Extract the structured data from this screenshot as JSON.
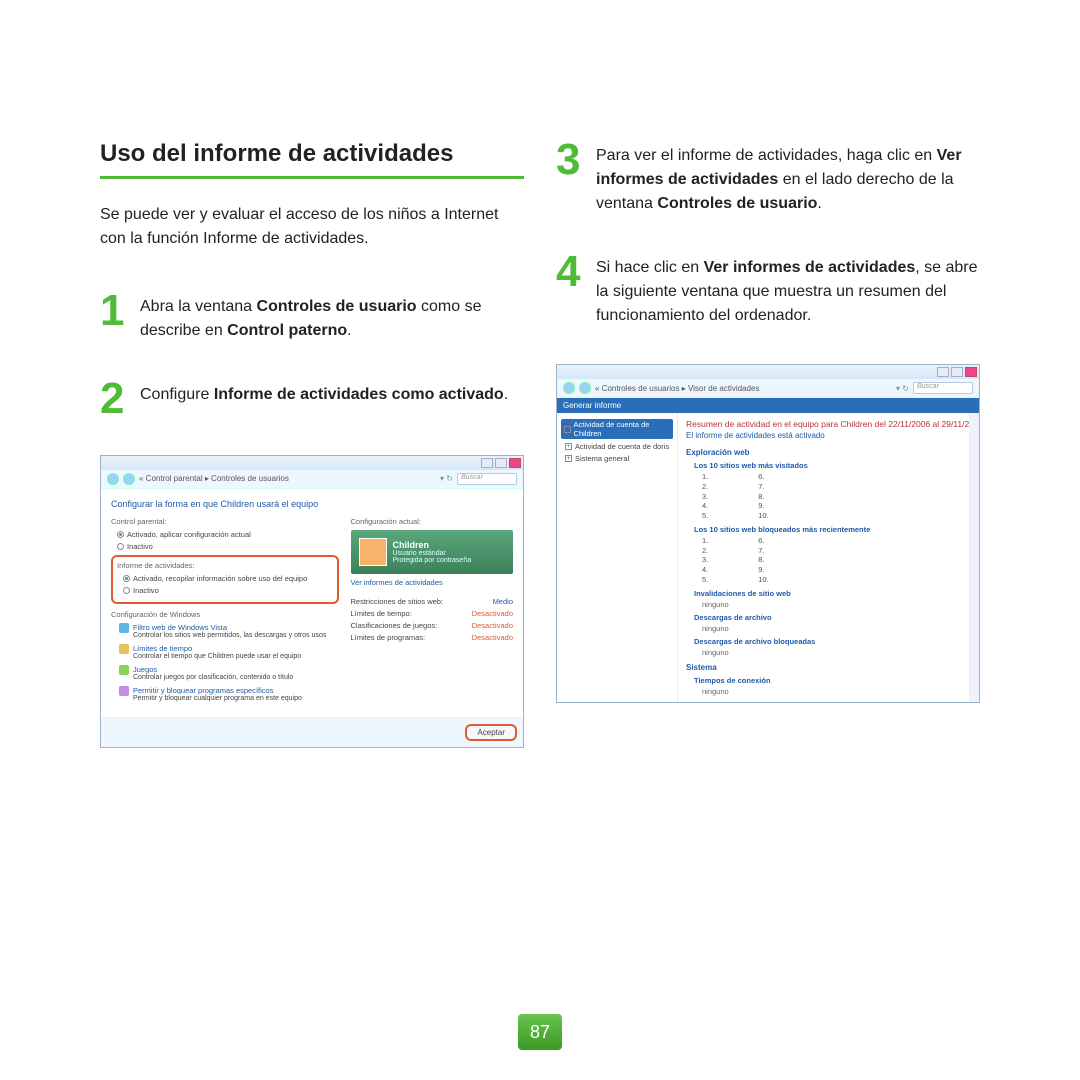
{
  "title": "Uso del informe de actividades",
  "intro": "Se puede ver y evaluar el acceso de los niños a Internet con la función Informe de actividades.",
  "steps": {
    "s1": {
      "num": "1",
      "pre": "Abra la ventana ",
      "b1": "Controles de usuario",
      "mid": " como se describe en ",
      "b2": "Control paterno",
      "post": "."
    },
    "s2": {
      "num": "2",
      "pre": "Configure ",
      "b1": "Informe de actividades como activado",
      "post": "."
    },
    "s3": {
      "num": "3",
      "pre": "Para ver el informe de actividades, haga clic en ",
      "b1": "Ver informes de actividades",
      "mid": " en el lado derecho de la ventana ",
      "b2": "Controles de usuario",
      "post": "."
    },
    "s4": {
      "num": "4",
      "pre": "Si hace clic en ",
      "b1": "Ver informes de actividades",
      "post": ", se abre la siguiente ventana que muestra un resumen del funcionamiento del ordenador."
    }
  },
  "shot1": {
    "breadcrumb": "« Control parental ▸ Controles de usuarios",
    "search": "Buscar",
    "header": "Configurar la forma en que Children usará el equipo",
    "grp_parental": "Control parental:",
    "r_active": "Activado, aplicar configuración actual",
    "r_inactive": "Inactivo",
    "grp_report": "Informe de actividades:",
    "r_report_on": "Activado, recopilar información sobre uso del equipo",
    "r_report_off": "Inactivo",
    "grp_winconf": "Configuración de Windows",
    "links": {
      "l1_t": "Filtro web de Windows Vista",
      "l1_s": "Controlar los sitios web permitidos, las descargas y otros usos",
      "l2_t": "Límites de tiempo",
      "l2_s": "Controlar el tiempo que Children puede usar el equipo",
      "l3_t": "Juegos",
      "l3_s": "Controlar juegos por clasificación, contenido o título",
      "l4_t": "Permitir y bloquear programas específicos",
      "l4_s": "Permitir y bloquear cualquier programa en este equipo"
    },
    "grp_conf": "Configuración actual:",
    "user_name": "Children",
    "user_type": "Usuario estándar",
    "user_prot": "Protegida por contraseña",
    "view_link": "Ver informes de actividades",
    "kv": {
      "k1": "Restricciones de sitios web:",
      "v1": "Medio",
      "k2": "Límites de tiempo:",
      "v2": "Desactivado",
      "k3": "Clasificaciones de juegos:",
      "v3": "Desactivado",
      "k4": "Límites de programas:",
      "v4": "Desactivado"
    },
    "accept": "Aceptar"
  },
  "shot2": {
    "breadcrumb": "« Controles de usuarios ▸ Visor de actividades",
    "search": "Buscar",
    "bluebar": "Generar informe",
    "tree": {
      "t1": "Actividad de cuenta de Children",
      "t2": "Actividad de cuenta de doris",
      "t3": "Sistema general"
    },
    "title_red": "Resumen de actividad en el equipo para Children del 22/11/2006 al 29/11/2",
    "sub_blue": "El informe de actividades está activado",
    "sect_web": "Exploración web",
    "sub_visited": "Los 10 sitios web más visitados",
    "sub_blocked": "Los 10 sitios web bloqueados más recientemente",
    "sub_invalid": "Invalidaciones de sitio web",
    "txt_none": "ninguno",
    "sub_dl": "Descargas de archivo",
    "sub_dlb": "Descargas de archivo bloqueadas",
    "sect_sys": "Sistema",
    "sub_conn": "Tiempos de conexión",
    "nums_a": [
      "1.",
      "2.",
      "3.",
      "4.",
      "5."
    ],
    "nums_b": [
      "6.",
      "7.",
      "8.",
      "9.",
      "10."
    ]
  },
  "page_number": "87"
}
